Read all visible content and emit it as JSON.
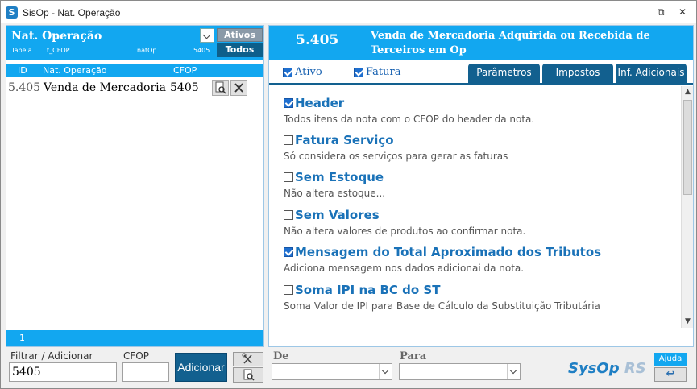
{
  "window": {
    "title": "SisOp - Nat. Operação",
    "restore_icon": "restore-icon",
    "close_icon": "close-icon"
  },
  "left_panel": {
    "title": "Nat. Operação",
    "table_label": "Tabela",
    "table_name": "t_CFOP",
    "key_field": "natOp",
    "key_value": "5405",
    "ativos_label": "Ativos",
    "todos_label": "Todos",
    "columns": [
      "ID",
      "Nat. Operação",
      "CFOP"
    ],
    "rows": [
      {
        "id": "5.405",
        "nat_operacao": "Venda de Mercadoria",
        "cfop": "5405"
      }
    ],
    "footer_count": "1"
  },
  "right_panel": {
    "code": "5.405",
    "description": "Venda de Mercadoria Adquirida ou Recebida de Terceiros em Op",
    "ativo": {
      "label": "Ativo",
      "checked": true
    },
    "fatura": {
      "label": "Fatura",
      "checked": true
    },
    "tabs": [
      "Parâmetros",
      "Impostos",
      "Inf. Adicionais"
    ],
    "options": [
      {
        "label": "Header",
        "desc": "Todos itens da nota com o CFOP do header da nota.",
        "checked": true
      },
      {
        "label": "Fatura Serviço",
        "desc": "Só considera os serviços para gerar as faturas",
        "checked": false
      },
      {
        "label": "Sem Estoque",
        "desc": "Não altera estoque...",
        "checked": false
      },
      {
        "label": "Sem Valores",
        "desc": "Não altera valores de produtos ao confirmar nota.",
        "checked": false
      },
      {
        "label": "Mensagem do Total Aproximado dos Tributos",
        "desc": "Adiciona mensagem nos dados adicionai da nota.",
        "checked": true
      },
      {
        "label": "Soma IPI na BC do ST",
        "desc": "Soma Valor de IPI para Base de Cálculo da Substituição Tributária",
        "checked": false
      }
    ]
  },
  "bottom": {
    "filter_label": "Filtrar / Adicionar",
    "filter_value": "5405",
    "cfop_label": "CFOP",
    "cfop_value": "",
    "add_label": "Adicionar",
    "de_label": "De",
    "para_label": "Para",
    "brand_main": "SysOp",
    "brand_suffix": "RS",
    "help_label": "Ajuda"
  },
  "colors": {
    "accent": "#12a7f0",
    "dark_accent": "#12608f",
    "option_label": "#1a72b8"
  }
}
